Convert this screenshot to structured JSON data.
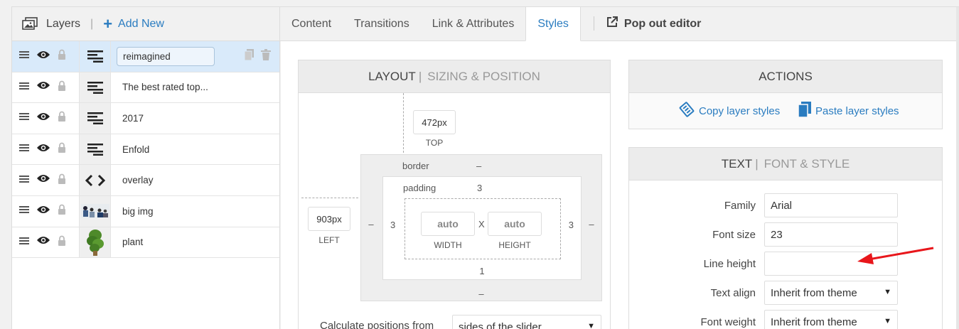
{
  "layers_panel": {
    "title": "Layers",
    "add_new": "Add New",
    "rows": [
      {
        "name": "reimagined",
        "icon": "text-layer-icon",
        "selected": true
      },
      {
        "name": "The best rated top...",
        "icon": "text-layer-icon"
      },
      {
        "name": "2017",
        "icon": "text-layer-icon"
      },
      {
        "name": "Enfold",
        "icon": "text-layer-icon"
      },
      {
        "name": "overlay",
        "icon": "code-layer-icon"
      },
      {
        "name": "big img",
        "icon": "image-thumbnail"
      },
      {
        "name": "plant",
        "icon": "image-thumbnail"
      }
    ]
  },
  "tabs": [
    "Content",
    "Transitions",
    "Link & Attributes",
    "Styles"
  ],
  "active_tab": "Styles",
  "pop_out": "Pop out editor",
  "layout_panel": {
    "title": "LAYOUT",
    "subtitle": "SIZING & POSITION",
    "top_value": "472px",
    "top_label": "TOP",
    "left_value": "903px",
    "left_label": "LEFT",
    "margin_left": "–",
    "margin_right": "–",
    "margin_bottom": "–",
    "border_label": "border",
    "border_value": "–",
    "padding_label": "padding",
    "padding_top": "3",
    "padding_left": "3",
    "padding_right": "3",
    "padding_bottom": "1",
    "width_value": "auto",
    "width_label": "WIDTH",
    "height_value": "auto",
    "height_label": "HEIGHT",
    "x_sep": "X",
    "calc_label": "Calculate positions from",
    "calc_value": "sides of the slider"
  },
  "actions_panel": {
    "title": "ACTIONS",
    "copy": "Copy layer styles",
    "paste": "Paste layer styles"
  },
  "text_panel": {
    "title": "TEXT",
    "subtitle": "FONT & STYLE",
    "family_label": "Family",
    "family_value": "Arial",
    "font_size_label": "Font size",
    "font_size_value": "23",
    "line_height_label": "Line height",
    "line_height_value": "",
    "text_align_label": "Text align",
    "text_align_value": "Inherit from theme",
    "font_weight_label": "Font weight",
    "font_weight_value": "Inherit from theme"
  },
  "colors": {
    "accent": "#2a7cc0",
    "selection": "#d9eafa",
    "annotation_arrow": "#e8161b"
  }
}
